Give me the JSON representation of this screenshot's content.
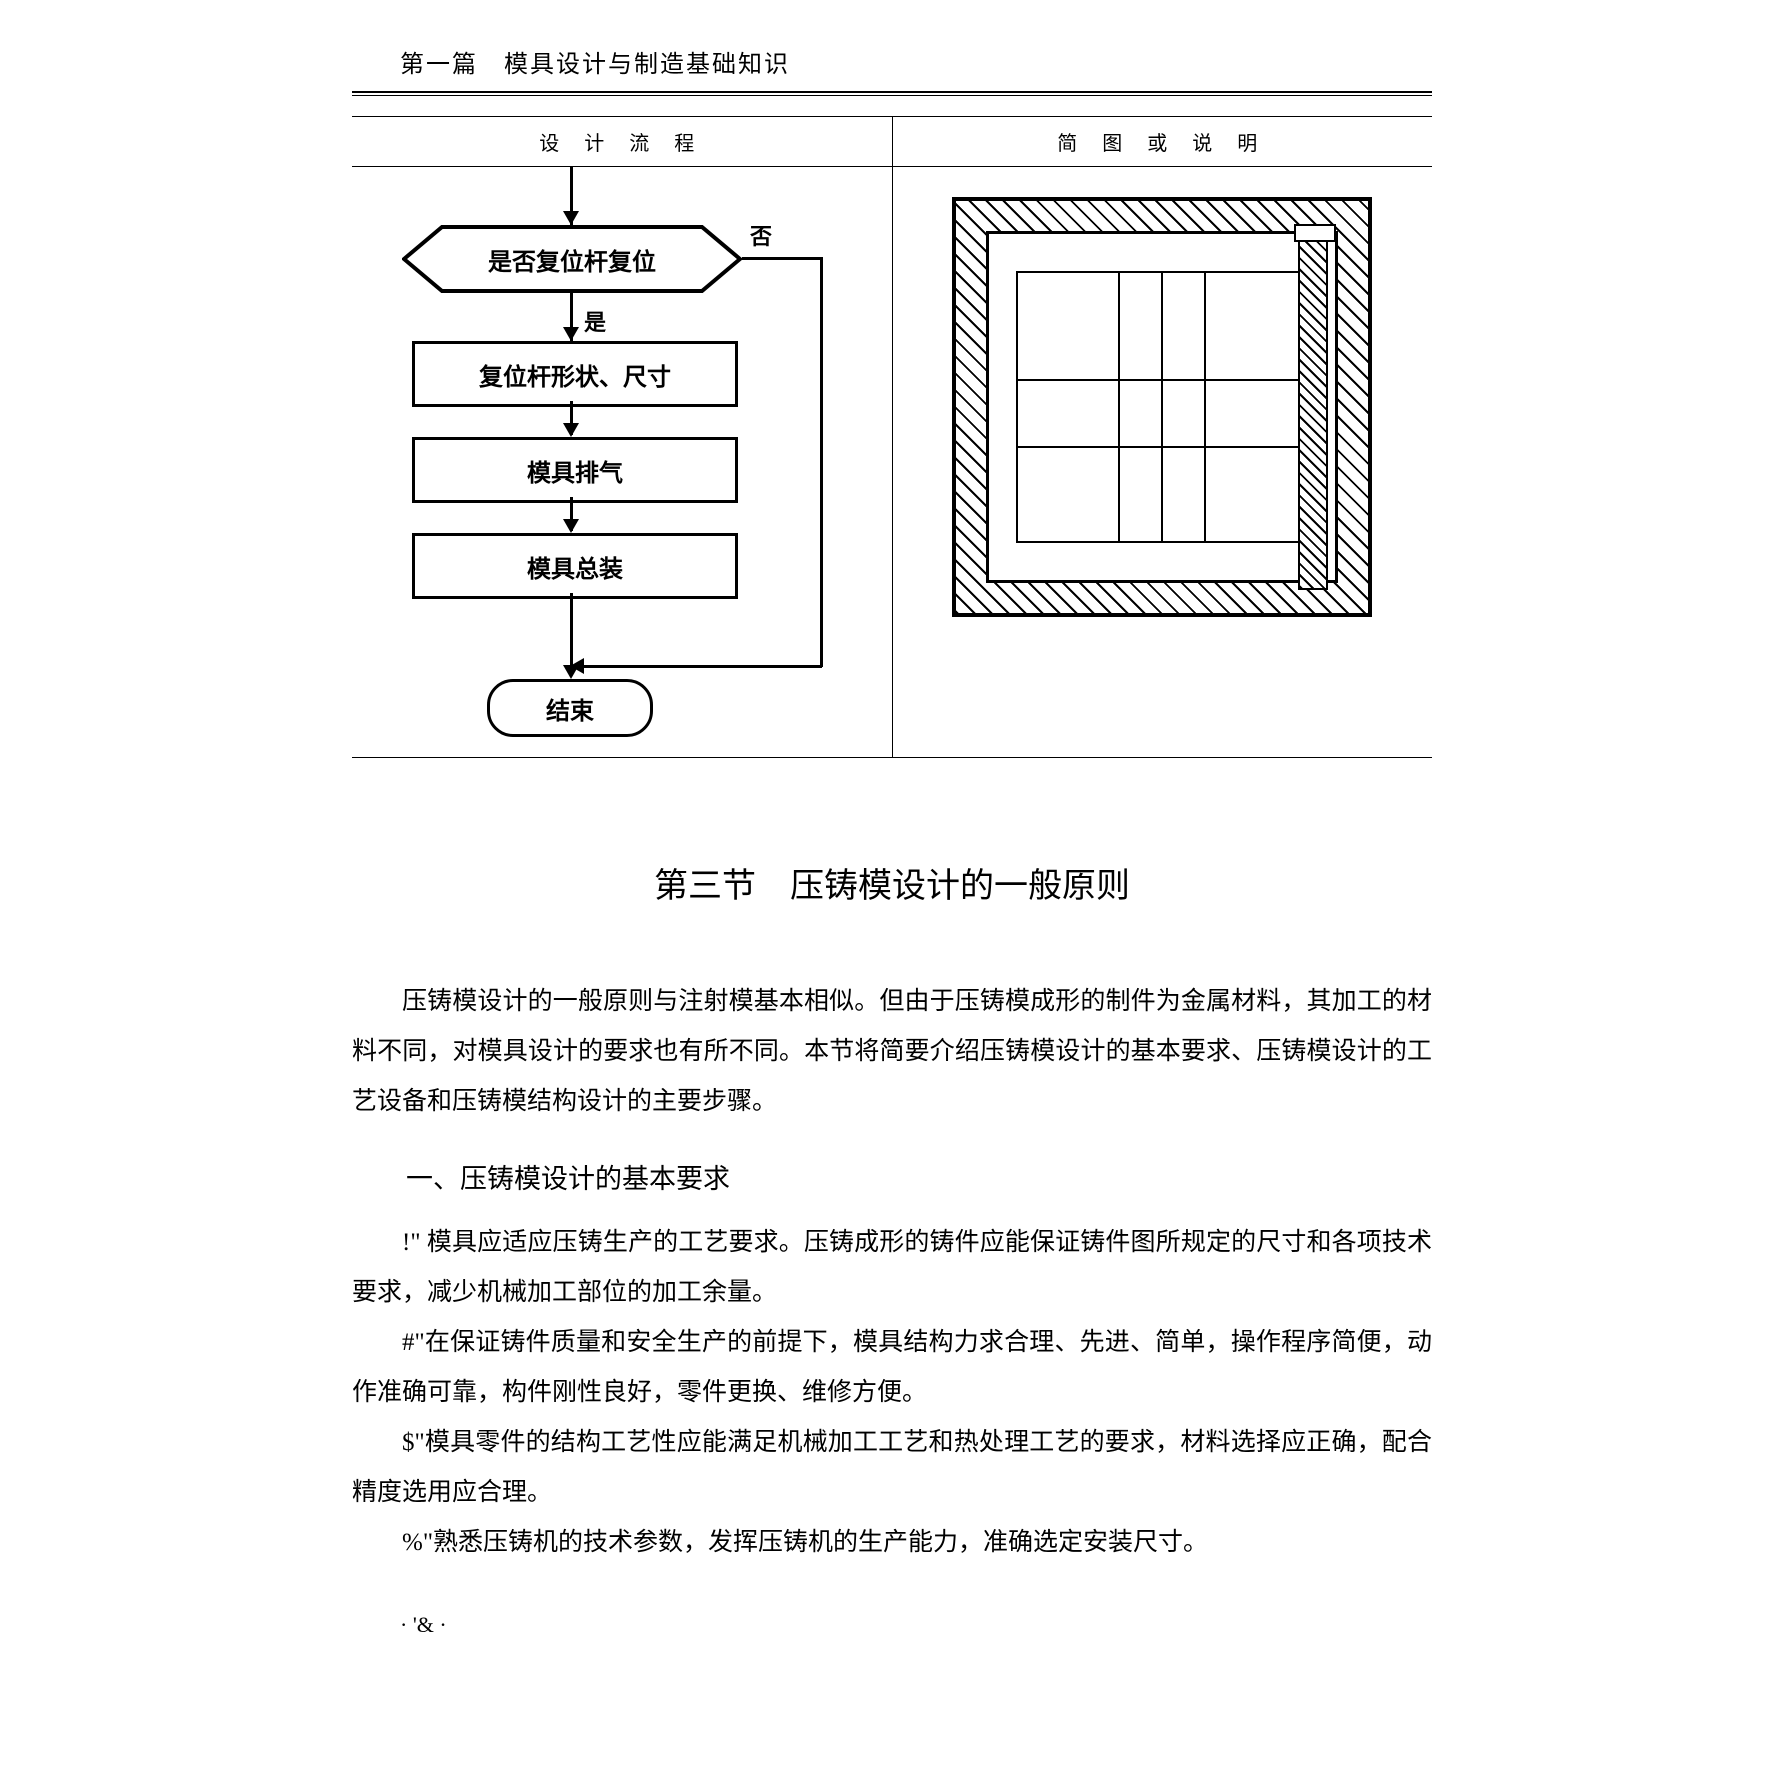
{
  "header": "第一篇　模具设计与制造基础知识",
  "table": {
    "left_head": "设 计 流 程",
    "right_head": "简 图 或 说 明"
  },
  "flowchart": {
    "decision": "是否复位杆复位",
    "decision_no": "否",
    "decision_yes": "是",
    "step1": "复位杆形状、尺寸",
    "step2": "模具排气",
    "step3": "模具总装",
    "terminal": "结束"
  },
  "section_title": "第三节　压铸模设计的一般原则",
  "intro": "压铸模设计的一般原则与注射模基本相似。但由于压铸模成形的制件为金属材料，其加工的材料不同，对模具设计的要求也有所不同。本节将简要介绍压铸模设计的基本要求、压铸模设计的工艺设备和压铸模结构设计的主要步骤。",
  "subhead1": "一、压铸模设计的基本要求",
  "item1_bullet": "!\"",
  "item1": " 模具应适应压铸生产的工艺要求。压铸成形的铸件应能保证铸件图所规定的尺寸和各项技术要求，减少机械加工部位的加工余量。",
  "item2_bullet": "#\"",
  "item2": "在保证铸件质量和安全生产的前提下，模具结构力求合理、先进、简单，操作程序简便，动作准确可靠，构件刚性良好，零件更换、维修方便。",
  "item3_bullet": "$\"",
  "item3": "模具零件的结构工艺性应能满足机械加工工艺和热处理工艺的要求，材料选择应正确，配合精度选用应合理。",
  "item4_bullet": "%\"",
  "item4": "熟悉压铸机的技术参数，发挥压铸机的生产能力，准确选定安装尺寸。",
  "page_number": "· '& ·"
}
